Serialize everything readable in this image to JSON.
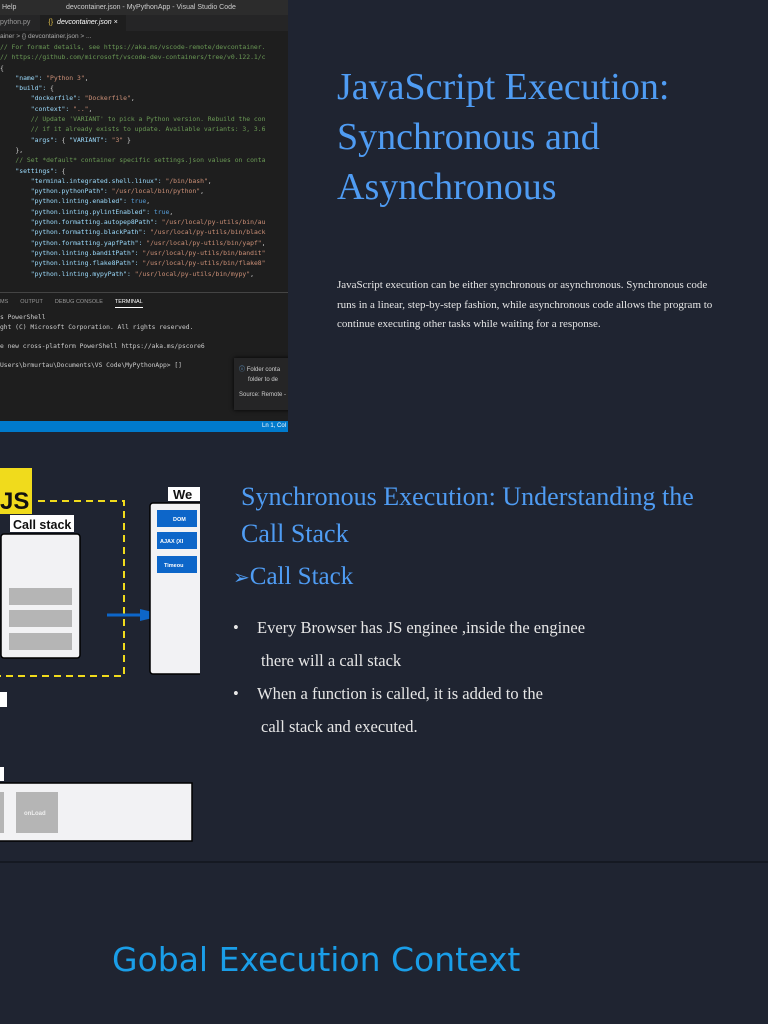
{
  "slide1": {
    "screenshot": {
      "menu": "Help",
      "window_title": "devcontainer.json - MyPythonApp - Visual Studio Code",
      "tabs": [
        "python.py",
        "devcontainer.json"
      ],
      "tab_close": "×",
      "tab_icon": "{}",
      "breadcrumb": "ainer > {} devcontainer.json > ...",
      "code_lines": [
        "// For format details, see https://aka.ms/vscode-remote/devcontainer.",
        "// https://github.com/microsoft/vscode-dev-containers/tree/v0.122.1/c",
        "{",
        "    \"name\": \"Python 3\",",
        "    \"build\": {",
        "        \"dockerfile\": \"Dockerfile\",",
        "        \"context\": \"..\",",
        "        // Update 'VARIANT' to pick a Python version. Rebuild the con",
        "        // if it already exists to update. Available variants: 3, 3.6",
        "        \"args\": { \"VARIANT\": \"3\" }",
        "    },",
        "",
        "    // Set *default* container specific settings.json values on conta",
        "    \"settings\": {",
        "        \"terminal.integrated.shell.linux\": \"/bin/bash\",",
        "        \"python.pythonPath\": \"/usr/local/bin/python\",",
        "        \"python.linting.enabled\": true,",
        "        \"python.linting.pylintEnabled\": true,",
        "        \"python.formatting.autopep8Path\": \"/usr/local/py-utils/bin/au",
        "        \"python.formatting.blackPath\": \"/usr/local/py-utils/bin/black",
        "        \"python.formatting.yapfPath\": \"/usr/local/py-utils/bin/yapf\",",
        "        \"python.linting.banditPath\": \"/usr/local/py-utils/bin/bandit\"",
        "        \"python.linting.flake8Path\": \"/usr/local/py-utils/bin/flake8\"",
        "        \"python.linting.mypyPath\": \"/usr/local/py-utils/bin/mypy\","
      ],
      "panel_tabs": [
        "MS",
        "OUTPUT",
        "DEBUG CONSOLE",
        "TERMINAL"
      ],
      "terminal_lines": [
        "s PowerShell",
        "ght (C) Microsoft Corporation. All rights reserved.",
        "",
        "e new cross-platform PowerShell https://aka.ms/pscore6",
        "",
        "Users\\brmurtau\\Documents\\VS Code\\MyPythonApp> []"
      ],
      "notification": {
        "icon": "info-icon",
        "line1": "Folder conta",
        "line2": "folder to de",
        "source": "Source: Remote -"
      },
      "status": "Ln 1, Col"
    },
    "title": "JavaScript Execution: Synchronous and Asynchronous",
    "body": "JavaScript execution can be either synchronous or asynchronous. Synchronous code runs in a linear, step-by-step fashion, while asynchronous code allows the program to continue executing other tasks while waiting for a response."
  },
  "slide2": {
    "diagram": {
      "js_logo": "JS",
      "call_stack": "Call stack",
      "web_apis": "We",
      "apis": [
        "DOM",
        "AJAX (XI",
        "Timeou"
      ],
      "onload": "onLoad",
      "accent": "#f0db1c",
      "api_color": "#0d66c9"
    },
    "title": "Synchronous Execution: Understanding the Call Stack",
    "subtitle": "Call Stack",
    "subtitle_marker": "➢",
    "bullets": [
      {
        "line1": "Every Browser has JS enginee ,inside the enginee",
        "line2": "there will a call stack"
      },
      {
        "line1": "When a function is called, it is added to the",
        "line2": "call stack and executed."
      }
    ],
    "bullet_marker": "•"
  },
  "slide3": {
    "title": "Gobal Execution Context"
  }
}
